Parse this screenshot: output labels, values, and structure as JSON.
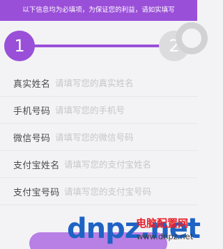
{
  "banner": {
    "notice": "以下信息均为必填项，为保证您的利益，请如实填写"
  },
  "steps": {
    "step1": "1",
    "step2": "2",
    "active_color": "#9a4fd8",
    "inactive_color": "#dcdcde"
  },
  "form": {
    "fields": [
      {
        "label": "真实姓名",
        "placeholder": "请填写您的真实姓名"
      },
      {
        "label": "手机号码",
        "placeholder": "请填写您的手机号"
      },
      {
        "label": "微信号码",
        "placeholder": "请填写您的微信号码"
      },
      {
        "label": "支付宝姓名",
        "placeholder": "请填写您的支付宝姓名"
      },
      {
        "label": "支付宝号码",
        "placeholder": "请填写您的支付宝号码"
      }
    ]
  },
  "watermark": {
    "logo": "dnpz.net",
    "site_name": "电脑配置网",
    "url": "www.dnpz.net"
  },
  "colors": {
    "accent": "#9a4fd8",
    "background": "#f3f3f5",
    "watermark_blue": "#1e63c4",
    "watermark_red": "#e8202a"
  }
}
